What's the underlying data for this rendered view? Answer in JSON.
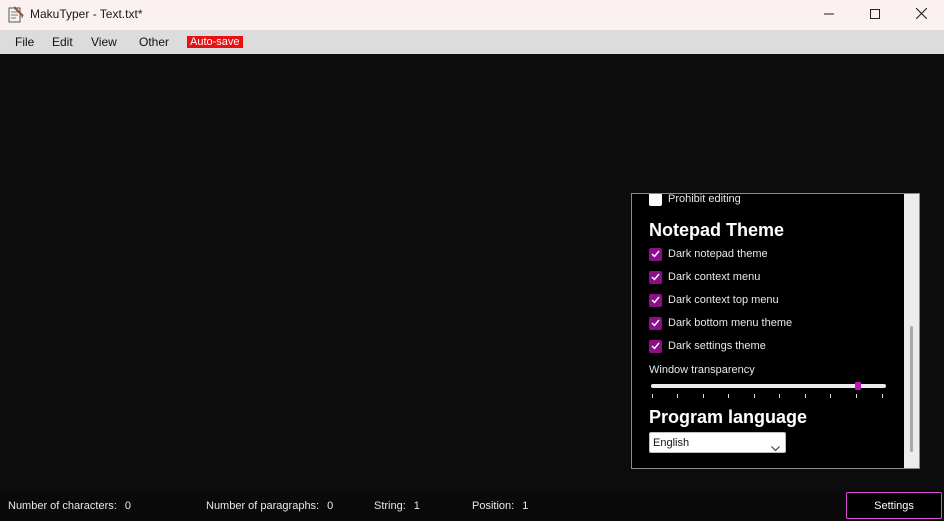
{
  "window": {
    "title": "MakuTyper - Text.txt*",
    "icon": "notepad-icon",
    "controls": [
      "minimize-icon",
      "maximize-icon",
      "close-icon"
    ]
  },
  "menubar": {
    "items": [
      {
        "label": "File"
      },
      {
        "label": "Edit"
      },
      {
        "label": "View"
      },
      {
        "label": "Other"
      }
    ],
    "autosave_label": "Auto-save",
    "autosave_color": "#e81010"
  },
  "editor": {
    "content": ""
  },
  "settings_panel": {
    "prohibit_editing": {
      "label": "Prohibit editing",
      "checked": false
    },
    "theme_title": "Notepad Theme",
    "theme_options": [
      {
        "label": "Dark notepad theme",
        "checked": true
      },
      {
        "label": "Dark context menu",
        "checked": true
      },
      {
        "label": "Dark context top menu",
        "checked": true
      },
      {
        "label": "Dark bottom menu theme",
        "checked": true
      },
      {
        "label": "Dark settings theme",
        "checked": true
      }
    ],
    "transparency_label": "Window transparency",
    "transparency_value_fraction": 0.88,
    "language_title": "Program language",
    "language_selected": "English",
    "accent_color": "#8b0f8a"
  },
  "statusbar": {
    "characters_label": "Number of characters:",
    "characters_value": "0",
    "paragraphs_label": "Number of paragraphs:",
    "paragraphs_value": "0",
    "string_label": "String:",
    "string_value": "1",
    "position_label": "Position:",
    "position_value": "1",
    "settings_button": "Settings"
  }
}
